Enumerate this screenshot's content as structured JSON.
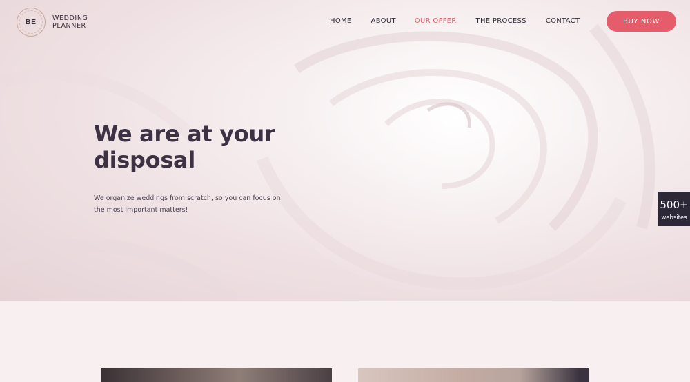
{
  "logo": {
    "mark": "BE",
    "line1": "WEDDING",
    "line2": "PLANNER"
  },
  "nav": {
    "items": [
      {
        "label": "HOME"
      },
      {
        "label": "ABOUT"
      },
      {
        "label": "OUR OFFER",
        "active": true
      },
      {
        "label": "THE PROCESS"
      },
      {
        "label": "CONTACT"
      }
    ],
    "buy_label": "BUY NOW"
  },
  "hero": {
    "title_line1": "We are at your",
    "title_line2": "disposal",
    "subtitle": "We organize weddings from scratch, so you can focus on the most important matters!"
  },
  "side_badge": {
    "count": "500+",
    "label": "websites"
  },
  "colors": {
    "accent": "#e55d6b",
    "active_nav": "#e0606c",
    "heading": "#3c3244",
    "badge_bg": "#2c2838",
    "section_bg": "#f8eff0"
  }
}
